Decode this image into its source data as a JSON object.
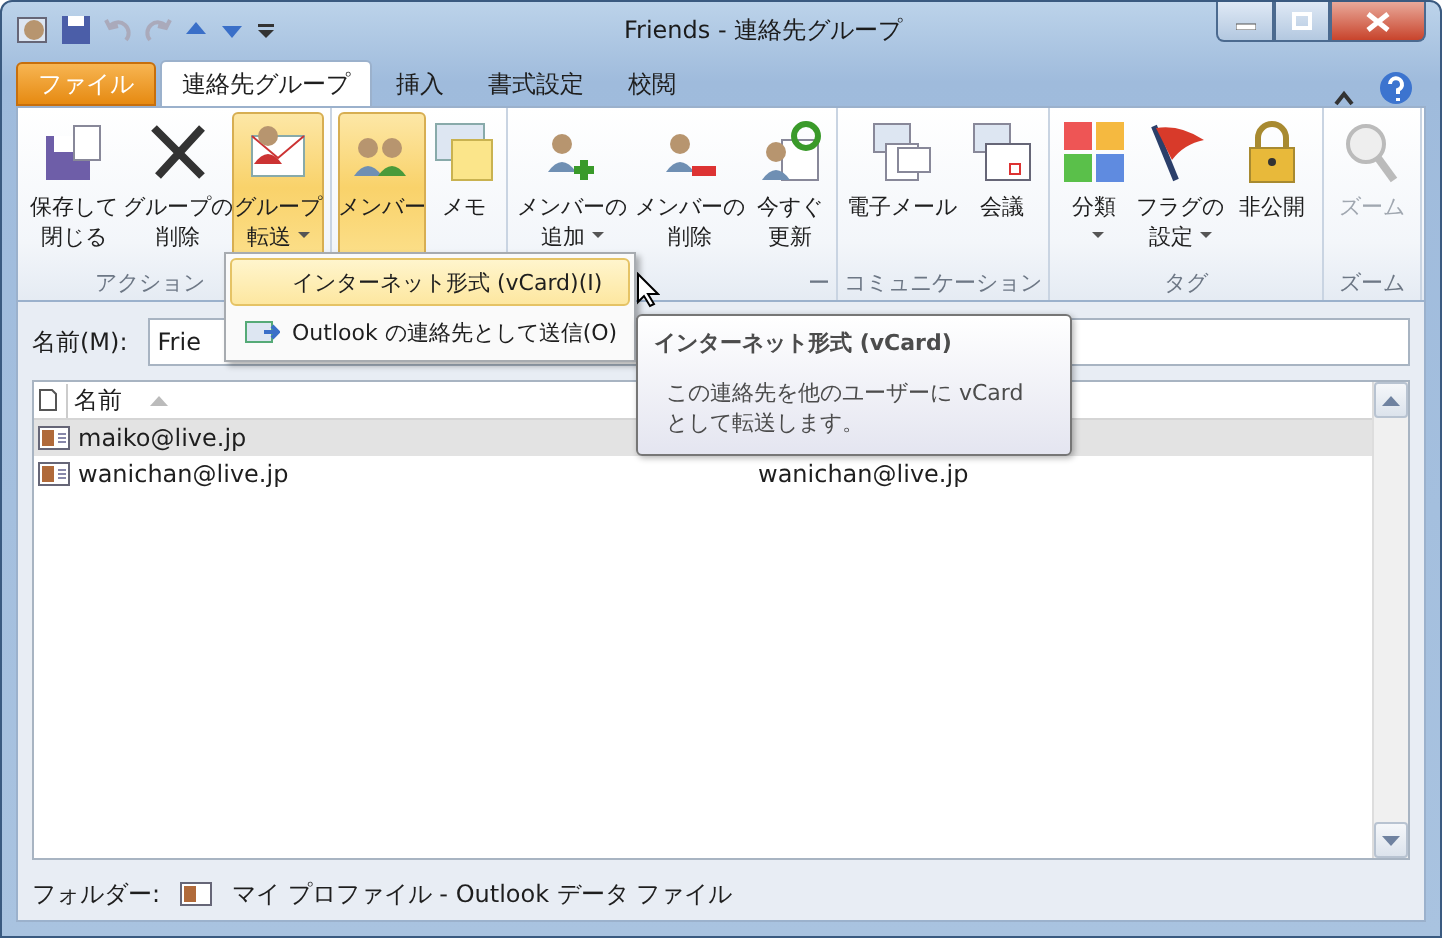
{
  "window": {
    "title": "Friends - 連絡先グループ"
  },
  "tabs": [
    {
      "label": "ファイル",
      "kind": "file",
      "selected": false
    },
    {
      "label": "連絡先グループ",
      "kind": "tab",
      "selected": true
    },
    {
      "label": "挿入",
      "kind": "tab",
      "selected": false
    },
    {
      "label": "書式設定",
      "kind": "tab",
      "selected": false
    },
    {
      "label": "校閲",
      "kind": "tab",
      "selected": false
    }
  ],
  "ribbon": [
    {
      "label": "アクション",
      "buttons": [
        {
          "label": "保存して閉じる",
          "pressed": false,
          "dropdown": false,
          "disabled": false
        },
        {
          "label": "グループの削除",
          "pressed": false,
          "dropdown": false,
          "disabled": false
        },
        {
          "label": "グループ転送",
          "pressed": true,
          "dropdown": true,
          "disabled": false
        }
      ]
    },
    {
      "buttons": [
        {
          "label": "メンバー",
          "pressed": true,
          "dropdown": false,
          "disabled": false
        },
        {
          "label": "メモ",
          "pressed": false,
          "dropdown": false,
          "disabled": false
        }
      ]
    },
    {
      "label": "ー",
      "buttons": [
        {
          "label": "メンバーの追加",
          "pressed": false,
          "dropdown": true,
          "disabled": false
        },
        {
          "label": "メンバーの削除",
          "pressed": false,
          "dropdown": false,
          "disabled": false
        },
        {
          "label": "今すぐ更新",
          "pressed": false,
          "dropdown": false,
          "disabled": false
        }
      ]
    },
    {
      "label": "コミュニケーション",
      "buttons": [
        {
          "label": "電子メール",
          "pressed": false,
          "dropdown": false,
          "disabled": false
        },
        {
          "label": "会議",
          "pressed": false,
          "dropdown": false,
          "disabled": false
        }
      ]
    },
    {
      "label": "タグ",
      "buttons": [
        {
          "label": "分類",
          "pressed": false,
          "dropdown": true,
          "disabled": false
        },
        {
          "label": "フラグの設定",
          "pressed": false,
          "dropdown": true,
          "disabled": false
        },
        {
          "label": "非公開",
          "pressed": false,
          "dropdown": false,
          "disabled": false
        }
      ]
    },
    {
      "label": "ズーム",
      "buttons": [
        {
          "label": "ズーム",
          "pressed": false,
          "dropdown": false,
          "disabled": true
        }
      ]
    }
  ],
  "name_field": {
    "label": "名前(M):",
    "value": "Frie"
  },
  "list": {
    "columns": [
      {
        "label": "名前"
      }
    ],
    "rows": [
      {
        "name": "maiko@live.jp",
        "selected": true
      },
      {
        "name": "wanichan@live.jp",
        "column_2": "wanichan@live.jp",
        "selected": false
      }
    ]
  },
  "menu": {
    "items": [
      {
        "label": "インターネット形式 (vCard)(I)",
        "selected": true
      },
      {
        "label": "Outlook の連絡先として送信(O)",
        "selected": false
      }
    ]
  },
  "tooltip": {
    "title": "インターネット形式 (vCard)",
    "text": "この連絡先を他のユーザーに vCard\nとして転送します。"
  },
  "status_bar": {
    "label": "フォルダー:",
    "folder": "マイ プロファイル - Outlook データ ファイル"
  }
}
